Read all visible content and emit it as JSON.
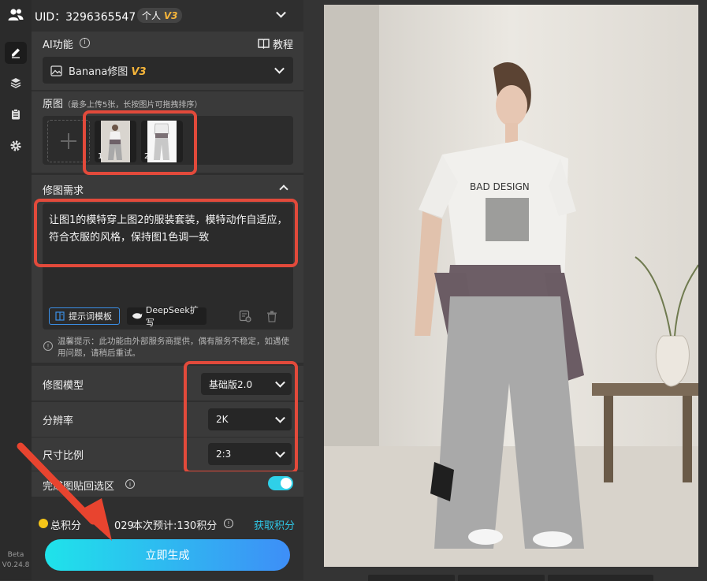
{
  "header": {
    "uid_text": "UID：3296365547",
    "account_tag": "个人",
    "account_tag_version": "V3"
  },
  "rail": {
    "version_line1": "Beta",
    "version_line2": "V0.24.8"
  },
  "ai_function": {
    "label": "AI功能",
    "tutorial": "教程",
    "selected": "Banana修图",
    "selected_version": "V3"
  },
  "source_images": {
    "label": "原图",
    "hint": "（最多上传5张，长按图片可拖拽排序）",
    "thumb_numbers": [
      "1",
      "2"
    ]
  },
  "request": {
    "label": "修图需求",
    "text": "让图1的模特穿上图2的服装套装，模特动作自适应，符合衣服的风格，保持图1色调一致",
    "template_button": "提示词模板",
    "deepseek_button": "DeepSeek扩写"
  },
  "notice": "温馨提示：此功能由外部服务商提供，偶有服务不稳定，如遇使用问题，请稍后重试。",
  "settings": {
    "model_label": "修图模型",
    "model_value": "基础版2.0",
    "resolution_label": "分辨率",
    "resolution_value": "2K",
    "ratio_label": "尺寸比例",
    "ratio_value": "2:3",
    "paste_label": "完成图贴回选区",
    "paste_toggle": true
  },
  "points": {
    "total_label": "总积分",
    "total_value": "029",
    "estimate": "本次预计:130积分",
    "get_link": "获取积分"
  },
  "generate_button": "立即生成",
  "colors": {
    "accent_red": "#e24a3b",
    "button_start": "#1fe3ea",
    "button_end": "#3e8ef7",
    "toggle": "#2fd0e8",
    "version_gold": "#f6b53a"
  }
}
